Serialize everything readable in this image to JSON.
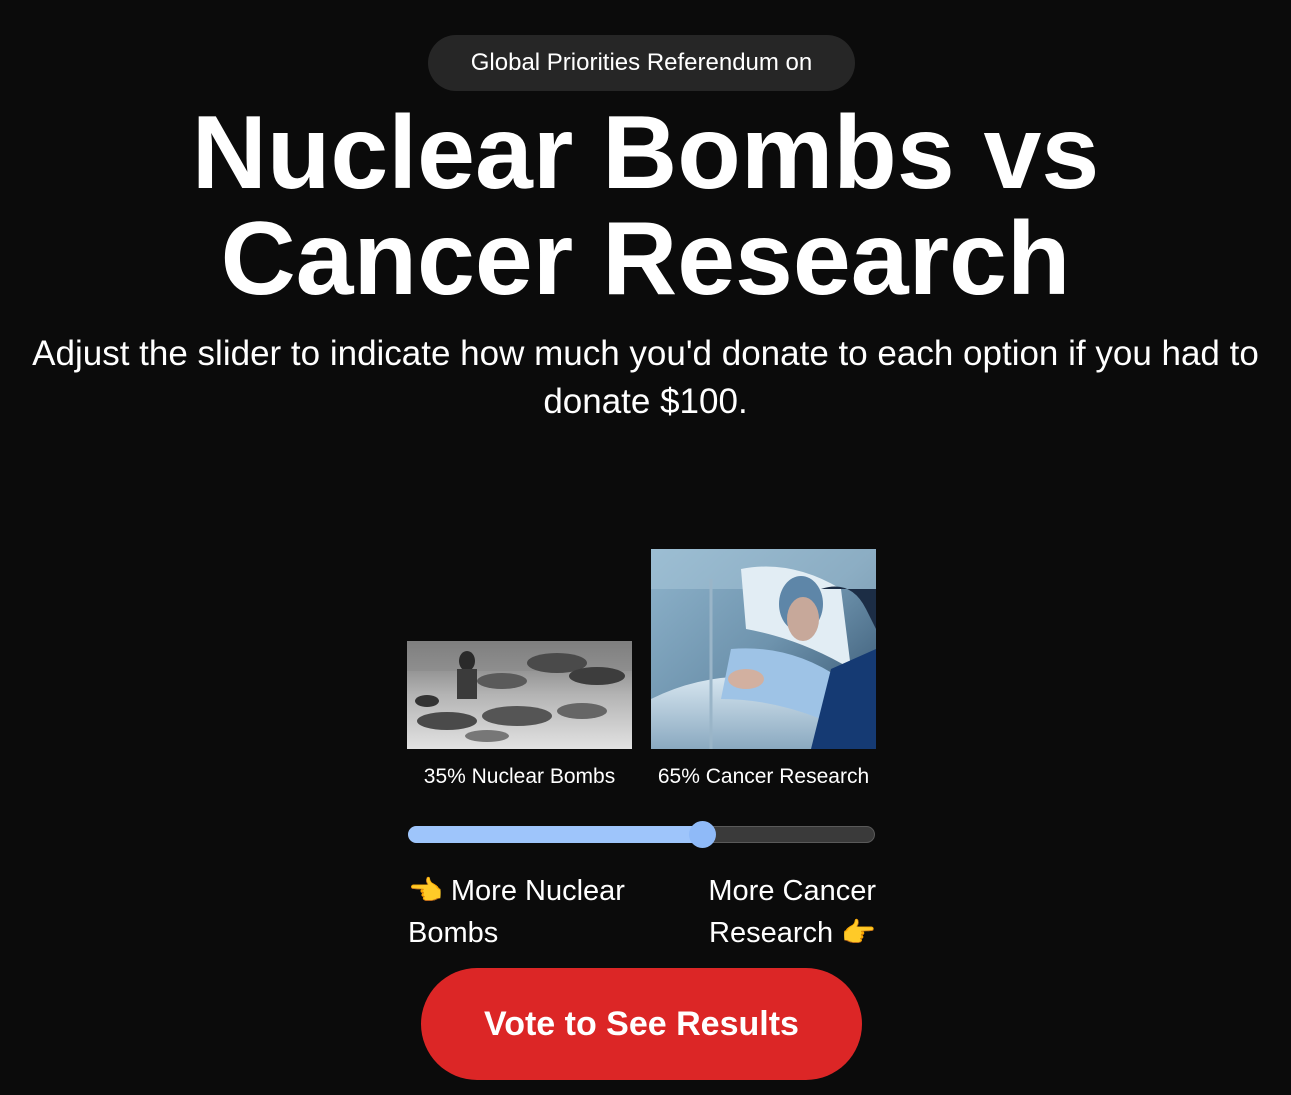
{
  "header": {
    "pill_label": "Global Priorities Referendum on",
    "title_line1": "Nuclear Bombs vs",
    "title_line2": "Cancer Research",
    "subtitle": "Adjust the slider to indicate how much you'd donate to each option if you had to donate $100."
  },
  "options": {
    "left": {
      "caption": "35% Nuclear Bombs",
      "percent": 35,
      "image_desc_icon": "photo-nuclear-victims-icon"
    },
    "right": {
      "caption": "65% Cancer Research",
      "percent": 65,
      "image_desc_icon": "photo-cancer-patient-icon"
    }
  },
  "slider": {
    "value_fraction_right": 0.63,
    "fill_color": "#9ec5fb",
    "track_color": "#3a3a3a"
  },
  "labels": {
    "more_left": "More Nuclear Bombs",
    "more_right": "More Cancer Research",
    "more_left_emoji": "👈",
    "more_right_emoji": "👉"
  },
  "cta": {
    "vote_label": "Vote to See Results",
    "color": "#dc2626"
  }
}
